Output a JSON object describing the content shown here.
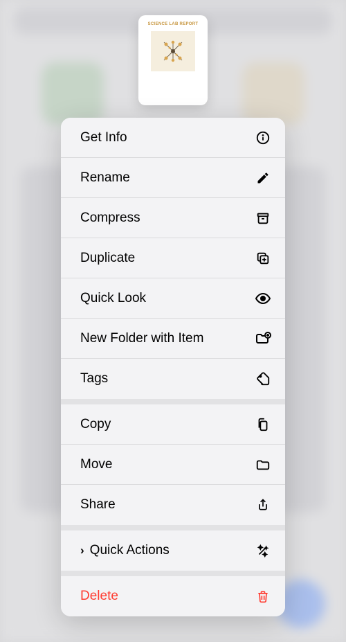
{
  "preview": {
    "title": "SCIENCE LAB REPORT",
    "subtitle": "",
    "footer1": "",
    "footer2": ""
  },
  "menu": {
    "groups": [
      {
        "id": "g1",
        "items": [
          {
            "id": "getinfo",
            "label": "Get Info",
            "icon": "info"
          },
          {
            "id": "rename",
            "label": "Rename",
            "icon": "pencil"
          },
          {
            "id": "compress",
            "label": "Compress",
            "icon": "archive"
          },
          {
            "id": "duplicate",
            "label": "Duplicate",
            "icon": "duplicate"
          },
          {
            "id": "quicklook",
            "label": "Quick Look",
            "icon": "eye"
          },
          {
            "id": "newfolder",
            "label": "New Folder with Item",
            "icon": "folder-plus"
          },
          {
            "id": "tags",
            "label": "Tags",
            "icon": "tag"
          }
        ]
      },
      {
        "id": "g2",
        "items": [
          {
            "id": "copy",
            "label": "Copy",
            "icon": "copy"
          },
          {
            "id": "move",
            "label": "Move",
            "icon": "folder"
          },
          {
            "id": "share",
            "label": "Share",
            "icon": "share"
          }
        ]
      },
      {
        "id": "g3",
        "items": [
          {
            "id": "quickactions",
            "label": "Quick Actions",
            "icon": "sparkle",
            "chevron": true
          }
        ]
      },
      {
        "id": "g4",
        "items": [
          {
            "id": "delete",
            "label": "Delete",
            "icon": "trash",
            "destructive": true
          }
        ]
      }
    ]
  }
}
